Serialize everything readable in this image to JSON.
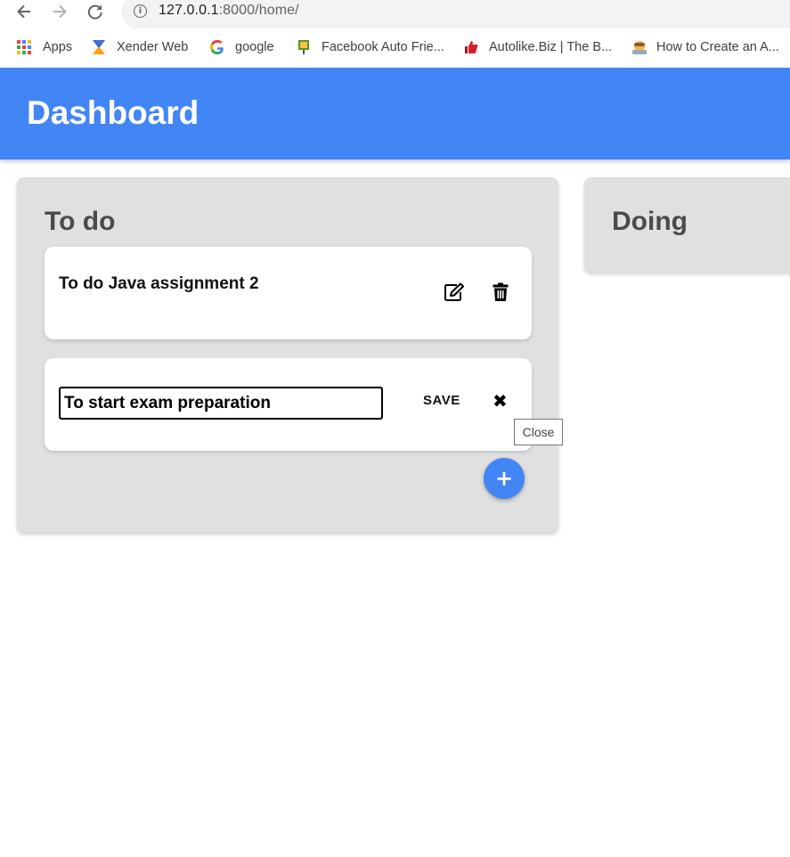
{
  "browser": {
    "url_host": "127.0.0.1",
    "url_path": ":8000/home/",
    "bookmarks": [
      {
        "label": "Apps",
        "icon": "apps-grid-icon"
      },
      {
        "label": "Xender Web",
        "icon": "xender-icon"
      },
      {
        "label": "google",
        "icon": "google-icon"
      },
      {
        "label": "Facebook Auto Frie...",
        "icon": "facebook-auto-friend-icon"
      },
      {
        "label": "Autolike.Biz | The B...",
        "icon": "autolike-icon"
      },
      {
        "label": "How to Create an A...",
        "icon": "how-to-create-icon"
      }
    ]
  },
  "app": {
    "title": "Dashboard",
    "accent_color": "#4285f4"
  },
  "columns": {
    "todo": {
      "title": "To do",
      "cards": [
        {
          "text": "To do Java assignment 2",
          "edit_icon": "edit-icon",
          "delete_icon": "trash-icon"
        }
      ],
      "edit_card": {
        "input_value": "To start exam preparation",
        "save_label": "SAVE",
        "close_icon": "close-icon",
        "close_tooltip": "Close"
      },
      "add_icon": "plus-icon"
    },
    "doing": {
      "title": "Doing"
    }
  }
}
